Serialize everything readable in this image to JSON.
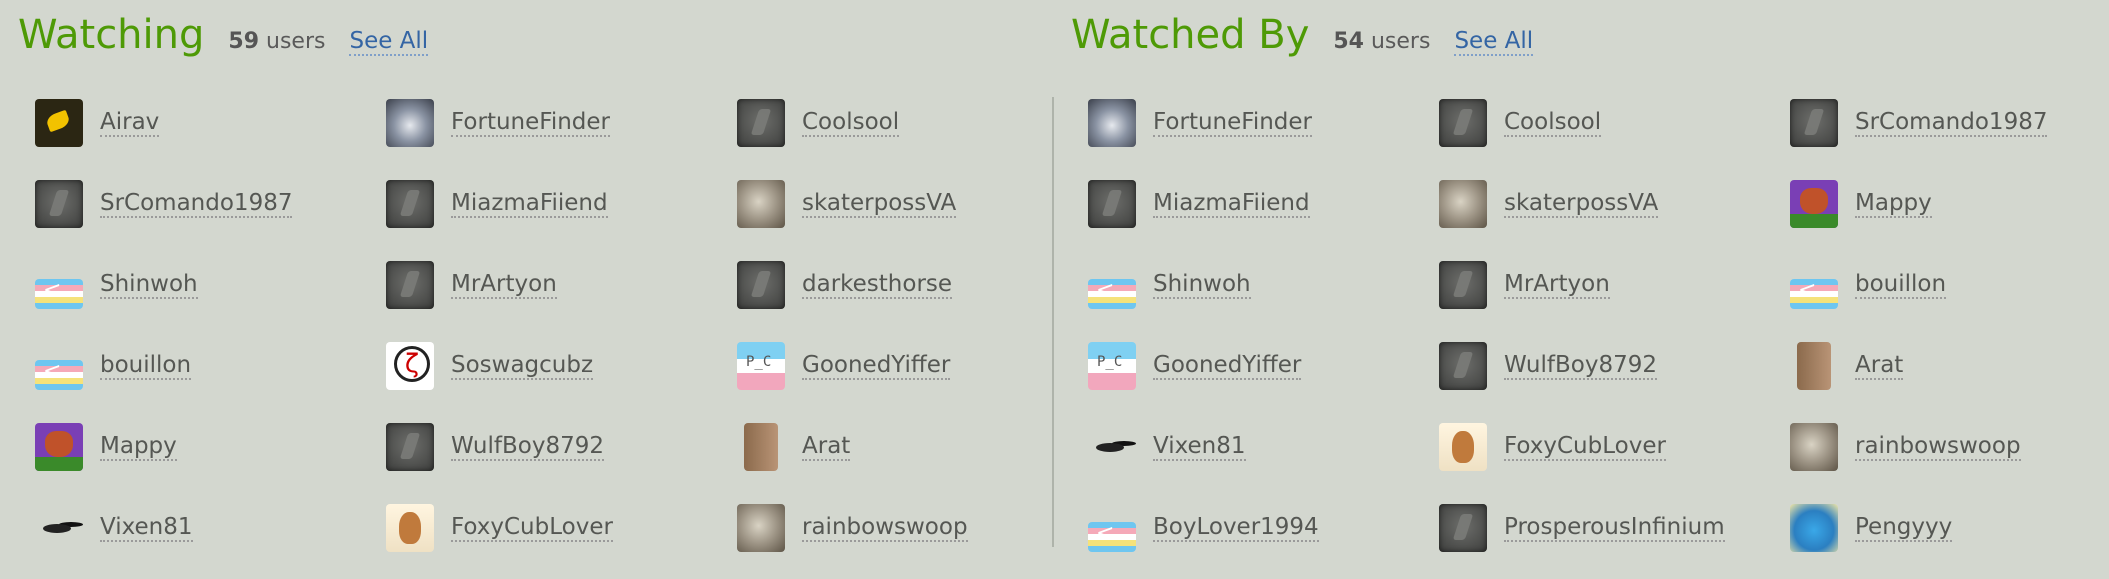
{
  "watching": {
    "title": "Watching",
    "count": "59",
    "count_suffix": "users",
    "see_all": "See All",
    "users": [
      {
        "name": "Airav",
        "avatar": "bird-avatar"
      },
      {
        "name": "FortuneFinder",
        "avatar": "wolf-avatar"
      },
      {
        "name": "Coolsool",
        "avatar": "default-avatar"
      },
      {
        "name": "SrComando1987",
        "avatar": "default-avatar"
      },
      {
        "name": "MiazmaFiiend",
        "avatar": "default-avatar"
      },
      {
        "name": "skaterpossVA",
        "avatar": "cat-avatar"
      },
      {
        "name": "Shinwoh",
        "avatar": "flag-avatar"
      },
      {
        "name": "MrArtyon",
        "avatar": "default-avatar"
      },
      {
        "name": "darkesthorse",
        "avatar": "default-avatar"
      },
      {
        "name": "bouillon",
        "avatar": "flag-avatar"
      },
      {
        "name": "Soswagcubz",
        "avatar": "ring-avatar"
      },
      {
        "name": "GoonedYiffer",
        "avatar": "face-avatar"
      },
      {
        "name": "Mappy",
        "avatar": "fox-avatar"
      },
      {
        "name": "WulfBoy8792",
        "avatar": "default-avatar"
      },
      {
        "name": "Arat",
        "avatar": "book-avatar"
      },
      {
        "name": "Vixen81",
        "avatar": "skunk-avatar"
      },
      {
        "name": "FoxyCubLover",
        "avatar": "doge-avatar"
      },
      {
        "name": "rainbowswoop",
        "avatar": "cat-avatar"
      }
    ]
  },
  "watched_by": {
    "title": "Watched By",
    "count": "54",
    "count_suffix": "users",
    "see_all": "See All",
    "users": [
      {
        "name": "FortuneFinder",
        "avatar": "wolf-avatar"
      },
      {
        "name": "Coolsool",
        "avatar": "default-avatar"
      },
      {
        "name": "SrComando1987",
        "avatar": "default-avatar"
      },
      {
        "name": "MiazmaFiiend",
        "avatar": "default-avatar"
      },
      {
        "name": "skaterpossVA",
        "avatar": "cat-avatar"
      },
      {
        "name": "Mappy",
        "avatar": "fox-avatar"
      },
      {
        "name": "Shinwoh",
        "avatar": "flag-avatar"
      },
      {
        "name": "MrArtyon",
        "avatar": "default-avatar"
      },
      {
        "name": "bouillon",
        "avatar": "flag-avatar"
      },
      {
        "name": "GoonedYiffer",
        "avatar": "face-avatar"
      },
      {
        "name": "WulfBoy8792",
        "avatar": "default-avatar"
      },
      {
        "name": "Arat",
        "avatar": "book-avatar"
      },
      {
        "name": "Vixen81",
        "avatar": "skunk-avatar"
      },
      {
        "name": "FoxyCubLover",
        "avatar": "doge-avatar"
      },
      {
        "name": "rainbowswoop",
        "avatar": "cat-avatar"
      },
      {
        "name": "BoyLover1994",
        "avatar": "flag-avatar"
      },
      {
        "name": "ProsperousInfinium",
        "avatar": "default-avatar"
      },
      {
        "name": "Pengyyy",
        "avatar": "penguin-avatar"
      }
    ]
  },
  "colors": {
    "background": "#d3d7cf",
    "title": "#4e9a06",
    "link": "#3465a4",
    "text": "#555753"
  }
}
